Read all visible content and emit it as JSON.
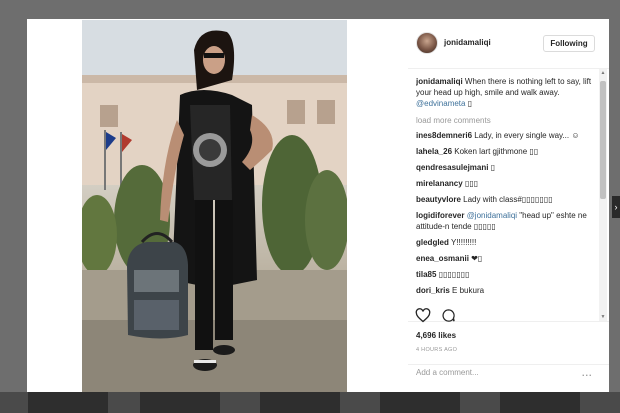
{
  "post": {
    "username": "jonidamaliqi",
    "follow_label": "Following",
    "caption_text": "When there is nothing left to say, lift your head up high, smile and walk away.",
    "caption_mention": "@edvinameta",
    "caption_emoji": "▯",
    "load_more_label": "load more comments",
    "likes": "4,696 likes",
    "time_ago": "4 HOURS AGO",
    "add_comment_placeholder": "Add a comment...",
    "more_options": "...",
    "comments": [
      {
        "user": "ines8demneri6",
        "text": "Lady, in every single way... ☺"
      },
      {
        "user": "lahela_26",
        "text": "Koken lart gjithmone ▯▯"
      },
      {
        "user": "qendresasulejmani",
        "text": "▯"
      },
      {
        "user": "mirelanancy",
        "text": "▯▯▯"
      },
      {
        "user": "beautyvlore",
        "text": "Lady with class#▯▯▯▯▯▯▯"
      },
      {
        "user": "logidiforever",
        "mention": "@jonidamaliqi",
        "text": "\"head up\" eshte ne attitude-n tende ▯▯▯▯▯"
      },
      {
        "user": "gledgled",
        "text": "Y!!!!!!!!!"
      },
      {
        "user": "enea_osmanii",
        "text": "❤▯"
      },
      {
        "user": "tila85",
        "text": "▯▯▯▯▯▯▯"
      },
      {
        "user": "dori_kris",
        "text": "E bukura"
      }
    ]
  },
  "icons": {
    "like": "heart-outline-icon",
    "comment": "comment-bubble-icon"
  },
  "colors": {
    "link": "#3f729b",
    "muted": "#999999",
    "text": "#262626"
  }
}
